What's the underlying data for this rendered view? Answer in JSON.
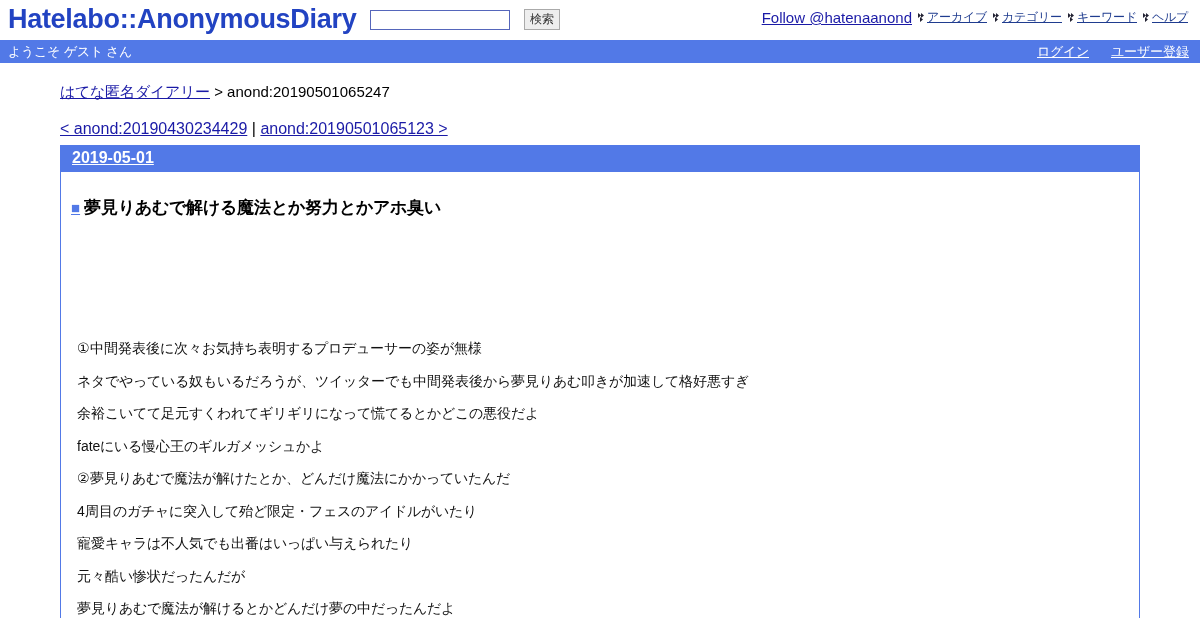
{
  "header": {
    "logo": "Hatelabo::AnonymousDiary",
    "search": {
      "button": "検索"
    },
    "follow_link": "Follow @hatenaanond",
    "nav_links": [
      "アーカイブ",
      "カテゴリー",
      "キーワード",
      "ヘルプ"
    ]
  },
  "user_bar": {
    "welcome": "ようこそ ゲスト さん",
    "links": [
      "ログイン",
      "ユーザー登録"
    ]
  },
  "breadcrumb": {
    "link": "はてな匿名ダイアリー",
    "current": "> anond:20190501065247"
  },
  "pager": {
    "prev": "< anond:20190430234429",
    "separator": "|",
    "next": "anond:20190501065123 >"
  },
  "entry": {
    "date": "2019-05-01",
    "mark": "■",
    "title": "夢見りあむで解ける魔法とか努力とかアホ臭い",
    "paragraphs": [
      "①中間発表後に次々お気持ち表明するプロデューサーの姿が無様",
      "ネタでやっている奴もいるだろうが、ツイッターでも中間発表後から夢見りあむ叩きが加速して格好悪すぎ",
      "余裕こいてて足元すくわれてギリギリになって慌てるとかどこの悪役だよ",
      "fateにいる慢心王のギルガメッシュかよ",
      "②夢見りあむで魔法が解けたとか、どんだけ魔法にかかっていたんだ",
      "4周目のガチャに突入して殆ど限定・フェスのアイドルがいたり",
      "寵愛キャラは不人気でも出番はいっぱい与えられたり",
      "元々酷い惨状だったんだが",
      "夢見りあむで魔法が解けるとかどんだけ夢の中だったんだよ"
    ]
  }
}
